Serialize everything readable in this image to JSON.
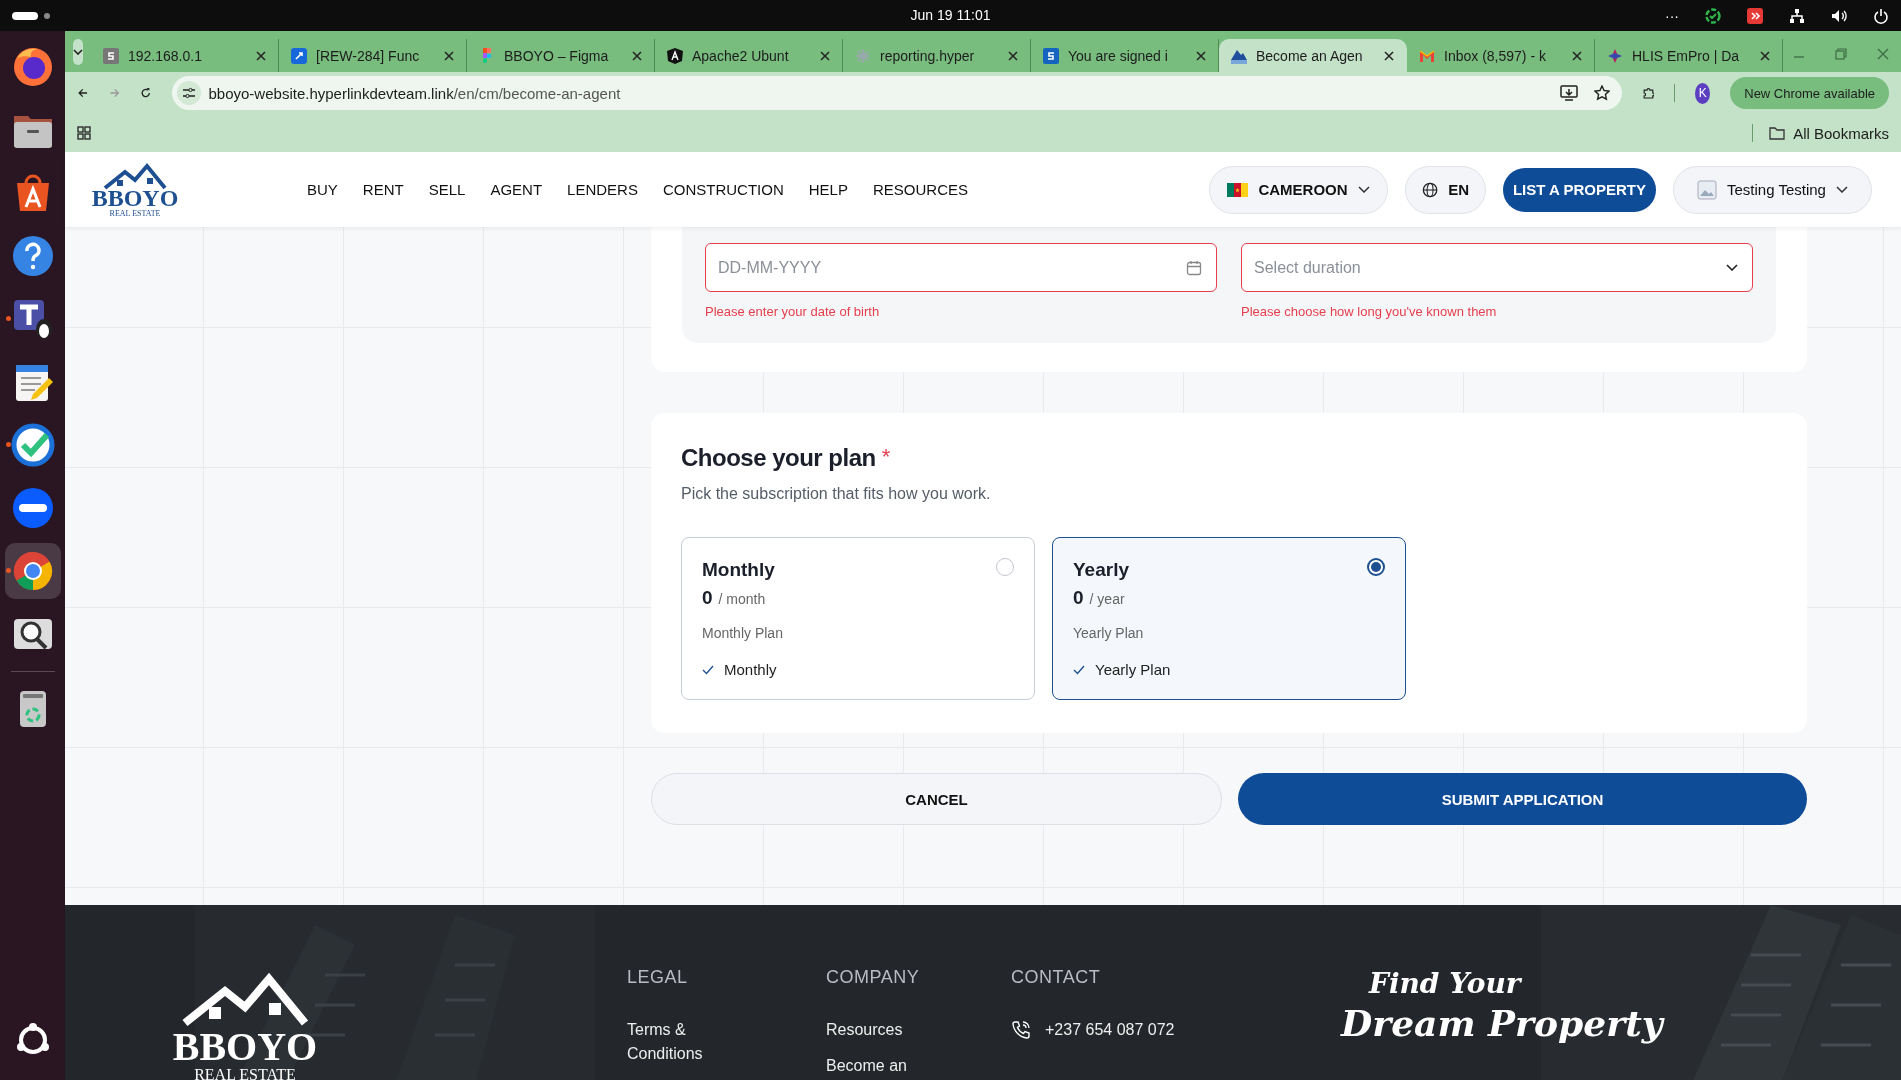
{
  "system_bar": {
    "date": "Jun 19",
    "time": "11:01",
    "overflow": "···"
  },
  "dock": {
    "apps": [
      {
        "kind": "firefox",
        "running": false
      },
      {
        "kind": "files",
        "running": false
      },
      {
        "kind": "store",
        "running": false
      },
      {
        "kind": "help",
        "running": false
      },
      {
        "kind": "teams",
        "running": true
      },
      {
        "kind": "editor",
        "running": false
      },
      {
        "kind": "check",
        "running": true
      },
      {
        "kind": "zoom",
        "running": false
      },
      {
        "kind": "chrome",
        "running": true
      },
      {
        "kind": "search",
        "running": false
      },
      {
        "kind": "trash",
        "running": false
      }
    ]
  },
  "browser": {
    "tabs": [
      {
        "title": "192.168.0.1",
        "selected": false
      },
      {
        "title": "[REW-284] Func",
        "selected": false
      },
      {
        "title": "BBOYO – Figma",
        "selected": false
      },
      {
        "title": "Apache2 Ubunt",
        "selected": false
      },
      {
        "title": "reporting.hyper",
        "selected": false
      },
      {
        "title": "You are signed i",
        "selected": false
      },
      {
        "title": "Become an Agen",
        "selected": true
      },
      {
        "title": "Inbox (8,597) - k",
        "selected": false
      },
      {
        "title": "HLIS EmPro | Da",
        "selected": false
      }
    ],
    "url_host": "bboyo-website.hyperlinkdevteam.link",
    "url_path": "/en/cm/become-an-agent",
    "profile_initial": "K",
    "update_button": "New Chrome available",
    "bookmarks": "All Bookmarks"
  },
  "site": {
    "logo": {
      "name": "BBOYO",
      "tagline": "REAL ESTATE"
    },
    "nav": [
      "BUY",
      "RENT",
      "SELL",
      "AGENT",
      "LENDERS",
      "CONSTRUCTION",
      "HELP",
      "RESOURCES"
    ],
    "country": "CAMEROON",
    "language": "EN",
    "list_button": "LIST A PROPERTY",
    "user": "Testing Testing"
  },
  "form": {
    "fields": [
      {
        "kind": "date",
        "placeholder": "DD-MM-YYYY",
        "error": "Please enter your date of birth"
      },
      {
        "kind": "select",
        "placeholder": "Select duration",
        "error": "Please choose how long you've known them"
      }
    ],
    "plan_section": {
      "title": "Choose your plan",
      "required_mark": "*",
      "subtitle": "Pick the subscription that fits how you work.",
      "plans": [
        {
          "name": "Monthly",
          "price": "0",
          "period": "/ month",
          "description": "Monthly Plan",
          "feature": "Monthly",
          "selected": false
        },
        {
          "name": "Yearly",
          "price": "0",
          "period": "/ year",
          "description": "Yearly Plan",
          "feature": "Yearly Plan",
          "selected": true
        }
      ]
    },
    "cancel": "CANCEL",
    "submit": "SUBMIT APPLICATION"
  },
  "footer": {
    "logo": {
      "name": "BBOYO",
      "tagline": "REAL ESTATE"
    },
    "columns": [
      {
        "heading": "LEGAL",
        "links": [
          "Terms & Conditions"
        ]
      },
      {
        "heading": "COMPANY",
        "links": [
          "Resources",
          "Become an"
        ]
      }
    ],
    "contact": {
      "heading": "CONTACT",
      "phone": "+237 654 087 072"
    },
    "slogan": {
      "line1": "Find Your",
      "line2": "Dream Property"
    }
  }
}
